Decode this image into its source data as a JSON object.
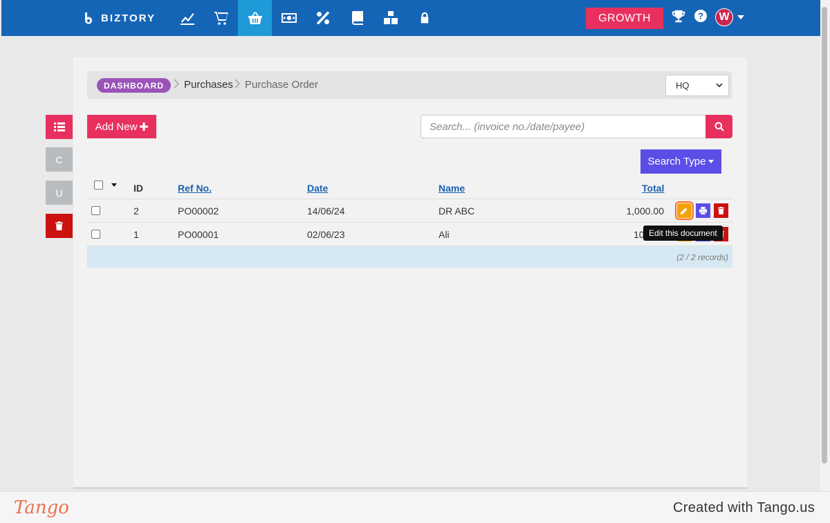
{
  "header": {
    "brand": "BIZTORY",
    "nav_icons": [
      "dashboard-chart-icon",
      "cart-icon",
      "basket-icon",
      "cash-icon",
      "percent-icon",
      "book-icon",
      "boxes-icon",
      "lock-icon"
    ],
    "active_nav": "basket-icon",
    "growth_label": "GROWTH",
    "avatar_initial": "W"
  },
  "breadcrumb": {
    "home": "DASHBOARD",
    "level1": "Purchases",
    "level2": "Purchase Order"
  },
  "branch_select": {
    "value": "HQ"
  },
  "toolbar": {
    "add_new_label": "Add New",
    "search_placeholder": "Search... (invoice no./date/payee)",
    "search_type_label": "Search Type"
  },
  "side_buttons": {
    "c_label": "C",
    "u_label": "U"
  },
  "table": {
    "headers": {
      "id": "ID",
      "ref": "Ref No.",
      "date": "Date",
      "name": "Name",
      "total": "Total"
    },
    "rows": [
      {
        "id": "2",
        "ref": "PO00002",
        "date": "14/06/24",
        "name": "DR ABC",
        "total": "1,000.00"
      },
      {
        "id": "1",
        "ref": "PO00001",
        "date": "02/06/23",
        "name": "Ali",
        "total": "10"
      }
    ],
    "record_count": "(2 / 2 records)"
  },
  "tooltip": "Edit this document",
  "footer": {
    "logo": "Tango",
    "credit": "Created with Tango.us"
  },
  "colors": {
    "nav_bg": "#1565b7",
    "nav_active": "#1e9ad9",
    "accent_pink": "#e8305f",
    "purple": "#5b4ee6",
    "edit_orange": "#f5a20a",
    "delete_red": "#cc1111"
  }
}
